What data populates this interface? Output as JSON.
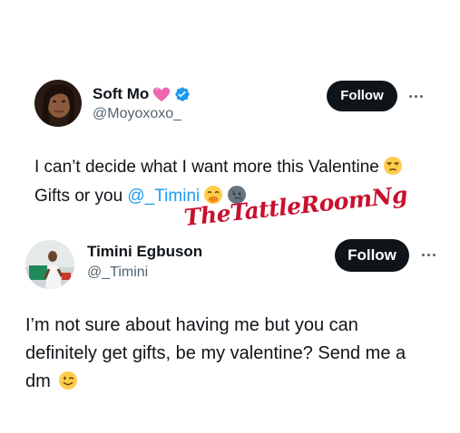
{
  "tweet1": {
    "display_name": "Soft Mo",
    "handle": "@Moyoxoxo_",
    "follow_label": "Follow",
    "text_line1": "I can’t decide what I want more this Valentine",
    "text_line2_pre": "Gifts or you ",
    "mention": "@_Timini",
    "heart_emoji": "pink-heart-icon",
    "verified_icon": "verified-badge-icon"
  },
  "watermark": {
    "text": "TheTattleRoomNg"
  },
  "tweet2": {
    "display_name": "Timini Egbuson",
    "handle": "@_Timini",
    "follow_label": "Follow",
    "text_line1": "I’m not sure about having me but you can",
    "text_line2": "definitely get gifts, be my valentine? Send me a",
    "text_line3": "dm"
  },
  "colors": {
    "text": "#0f1419",
    "secondary": "#536471",
    "link": "#1d9bf0",
    "follow_bg": "#0f1419",
    "watermark": "#c8102e"
  }
}
